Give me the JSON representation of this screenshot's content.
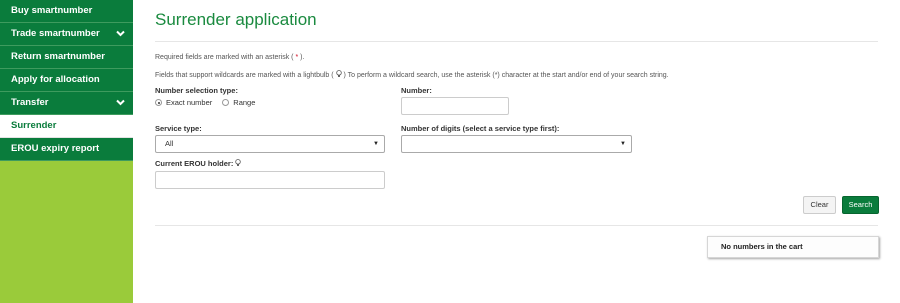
{
  "sidebar": {
    "items": [
      {
        "label": "Buy smartnumber"
      },
      {
        "label": "Trade smartnumber"
      },
      {
        "label": "Return smartnumber"
      },
      {
        "label": "Apply for allocation"
      },
      {
        "label": "Transfer"
      },
      {
        "label": "Surrender"
      },
      {
        "label": "EROU expiry report"
      }
    ]
  },
  "page": {
    "title": "Surrender application",
    "help_required_prefix": "Required fields are marked with an asterisk (",
    "help_required_star": " * ",
    "help_required_suffix": ").",
    "help_wildcard_prefix": "Fields that support wildcards are marked with a lightbulb (",
    "help_wildcard_suffix": ") To perform a wildcard search, use the asterisk (*) character at the start and/or end of your search string."
  },
  "form": {
    "number_selection_label": "Number selection type:",
    "option_exact": "Exact number",
    "option_range": "Range",
    "number_label": "Number:",
    "number_value": "",
    "service_type_label": "Service type:",
    "service_type_value": "All",
    "digits_label": "Number of digits (select a service type first):",
    "digits_value": "",
    "holder_label": "Current EROU holder:",
    "holder_value": ""
  },
  "buttons": {
    "clear": "Clear",
    "search": "Search"
  },
  "cart": {
    "empty_text": "No numbers in the cart"
  },
  "colors": {
    "brand_green": "#0a7c3c",
    "title_green": "#1a8a3f",
    "sidebar_lime": "#9acb3a",
    "asterisk_red": "#d0021b"
  },
  "icons": {
    "expand": "chevron-down-icon",
    "wildcard": "lightbulb-icon",
    "dropdown": "caret-down-icon"
  }
}
